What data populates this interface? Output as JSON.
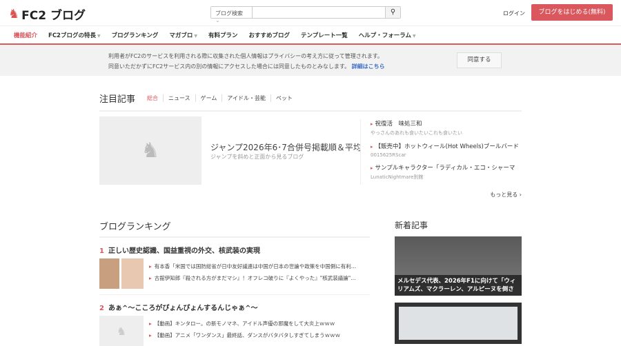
{
  "header": {
    "logo": "FC2 ブログ",
    "search_select": "ブログ検索",
    "search_placeholder": "",
    "login": "ログイン",
    "start": "ブログをはじめる(無料)"
  },
  "nav": [
    {
      "label": "機能紹介",
      "caret": false
    },
    {
      "label": "FC2ブログの特長",
      "caret": true
    },
    {
      "label": "ブログランキング",
      "caret": false
    },
    {
      "label": "マガブロ",
      "caret": true
    },
    {
      "label": "有料プラン",
      "caret": false
    },
    {
      "label": "おすすめブログ",
      "caret": false
    },
    {
      "label": "テンプレート一覧",
      "caret": false
    },
    {
      "label": "ヘルプ・フォーラム",
      "caret": true
    }
  ],
  "notice": {
    "line1": "利用者がFC2のサービスを利用される際に収集された個人情報はプライバシーの考え方に従って管理されます。",
    "line2": "同意いただかずにFC2サービス内の別の情報にアクセスした場合には同意したものとみなします。",
    "link": "詳細はこちら",
    "agree": "同意する"
  },
  "featured": {
    "title": "注目記事",
    "tabs": [
      "総合",
      "ニュース",
      "ゲーム",
      "アイドル・芸能",
      "ペット"
    ],
    "main_title": "ジャンプ2026年6･7合併号掲載順＆平均",
    "main_sub": "ジャンプを斜めと正面から見るブログ",
    "side": [
      {
        "t": "祝復活　味処三和",
        "s": "やっさんのあれも食いたいこれも食いたい"
      },
      {
        "t": "【販売中】ホットウィール(Hot Wheels)ブールバード",
        "s": "0015625RScar"
      },
      {
        "t": "サンプルキャラクター「ラディカル・エコ・シャーマ",
        "s": "LunaticNightmare別館"
      }
    ],
    "more": "もっと見る ›"
  },
  "ranking": {
    "title": "ブログランキング",
    "items": [
      {
        "n": "1",
        "title": "正しい歴史認識、国益重視の外交、核武装の実現",
        "links": [
          "有本香「米国では国防総省が日中友好議連は中国が日本の世論や政策を中国側に有利…",
          "古舘伊知郎『殺される方がまだマシ』！オフレコ破りに『よくやった』\"核武装議論\"…"
        ]
      },
      {
        "n": "2",
        "title": "あぁ^〜こころがぴょんぴょんするんじゃぁ^〜",
        "links": [
          "【動画】キンタロー。の新モノマネ、アイドル声優の邪魔をして大炎上ｗｗｗ",
          "【動画】アニメ「ワンダンス」最終話、ダンスがバタバタしすぎてしまうｗｗｗ"
        ]
      }
    ]
  },
  "new": {
    "title": "新着記事",
    "card1": "メルセデス代表、2026年F1に向けて「ウィリアムズ、マクラーレン、アルピーヌを倒さ"
  },
  "colors": {
    "accent": "#d9575d",
    "link": "#3a6bc4"
  }
}
